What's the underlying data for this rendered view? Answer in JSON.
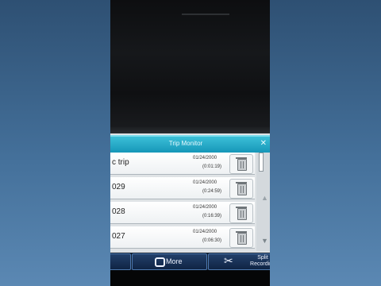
{
  "window": {
    "title": "Trip Monitor",
    "close_icon": "x-icon"
  },
  "trips": [
    {
      "name": "c trip",
      "date": "01/24/2000",
      "duration": "(0:01:19)",
      "icon": "trash-icon"
    },
    {
      "name": "029",
      "date": "01/24/2000",
      "duration": "(0:24:59)",
      "icon": "trash-icon"
    },
    {
      "name": "028",
      "date": "01/24/2000",
      "duration": "(0:16:39)",
      "icon": "trash-icon"
    },
    {
      "name": "027",
      "date": "01/24/2000",
      "duration": "(0:06:30)",
      "icon": "trash-icon"
    }
  ],
  "toolbar": {
    "more_label": "More",
    "split_label": "Split\nRecording"
  },
  "colors": {
    "titlebar": "#1596b8",
    "toolbar": "#102444",
    "background": "#3f6a92"
  }
}
